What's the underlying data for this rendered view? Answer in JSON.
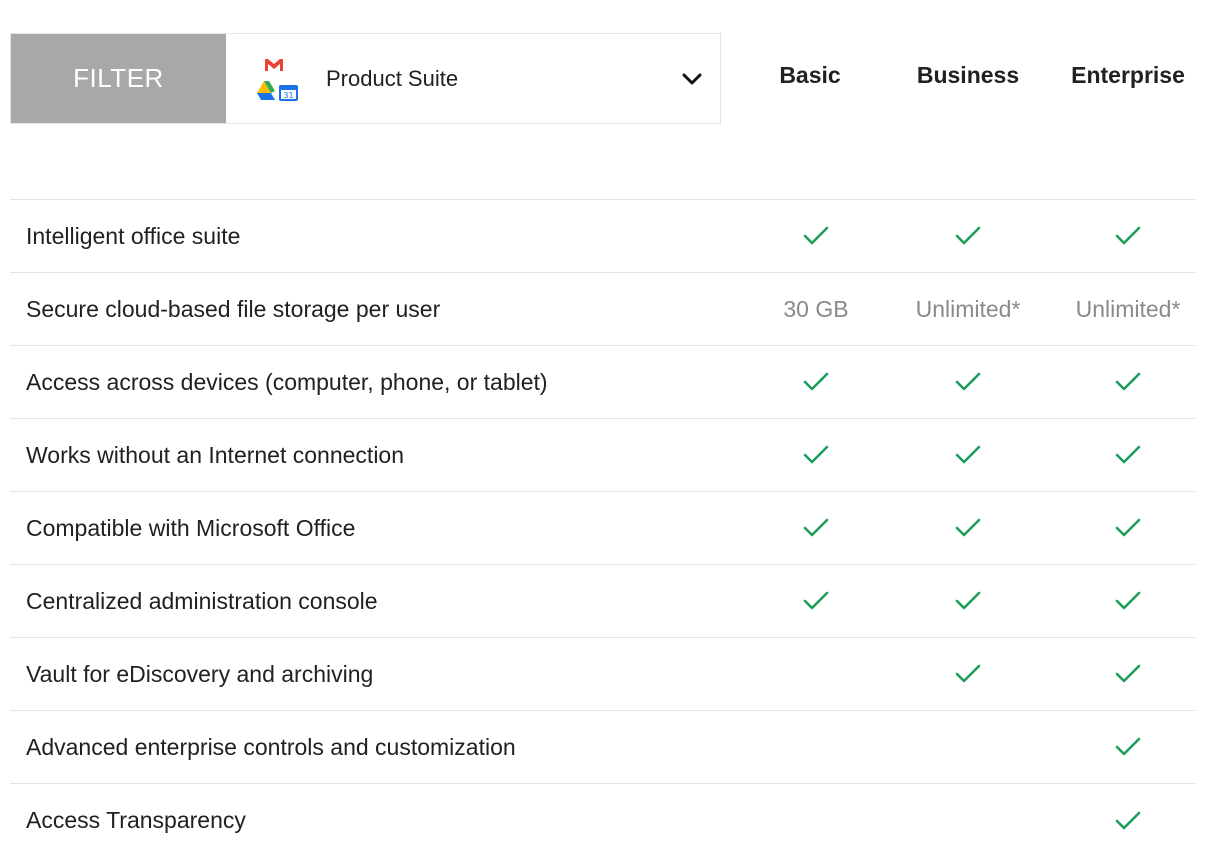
{
  "filter": {
    "label": "FILTER",
    "selected": "Product Suite",
    "icon": "google-workspace-suite-icon"
  },
  "plans": [
    "Basic",
    "Business",
    "Enterprise"
  ],
  "colors": {
    "check": "#1e9e5a",
    "filter_bg": "#a8a8a8",
    "muted_text": "#8a8a8a",
    "divider": "#e4e4e4"
  },
  "features": [
    {
      "name": "Intelligent office suite",
      "values": [
        "check",
        "check",
        "check"
      ]
    },
    {
      "name": "Secure cloud-based file storage per user",
      "values": [
        "30 GB",
        "Unlimited*",
        "Unlimited*"
      ]
    },
    {
      "name": "Access across devices (computer, phone, or tablet)",
      "values": [
        "check",
        "check",
        "check"
      ]
    },
    {
      "name": "Works without an Internet connection",
      "values": [
        "check",
        "check",
        "check"
      ]
    },
    {
      "name": "Compatible with Microsoft Office",
      "values": [
        "check",
        "check",
        "check"
      ]
    },
    {
      "name": "Centralized administration console",
      "values": [
        "check",
        "check",
        "check"
      ]
    },
    {
      "name": "Vault for eDiscovery and archiving",
      "values": [
        "",
        "check",
        "check"
      ]
    },
    {
      "name": "Advanced enterprise controls and customization",
      "values": [
        "",
        "",
        "check"
      ]
    },
    {
      "name": "Access Transparency",
      "values": [
        "",
        "",
        "check"
      ]
    }
  ]
}
